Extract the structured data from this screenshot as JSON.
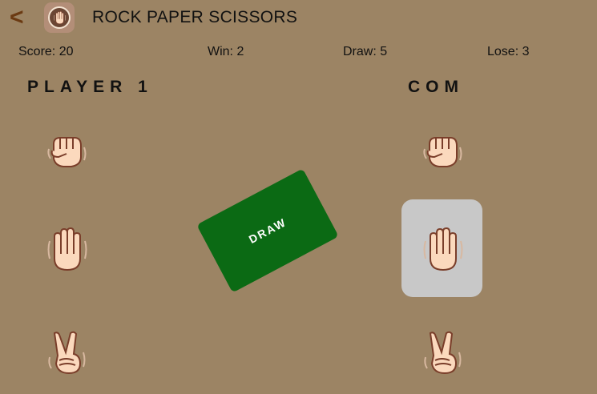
{
  "header": {
    "back_label": "<",
    "title": "ROCK PAPER SCISSORS"
  },
  "stats": {
    "score": "Score: 20",
    "win": "Win: 2",
    "draw": "Draw: 5",
    "lose": "Lose: 3"
  },
  "player": {
    "label": "PLAYER 1",
    "choices": [
      "rock-icon",
      "paper-icon",
      "scissors-icon"
    ]
  },
  "com": {
    "label": "COM",
    "choices": [
      "rock-icon",
      "paper-icon",
      "scissors-icon"
    ],
    "selected": "paper"
  },
  "result": {
    "label": "DRAW"
  },
  "colors": {
    "background": "#9c8464",
    "result_card": "#0b6a14",
    "selected_highlight": "#c8c8c8",
    "hand_skin": "#fbd9bd"
  }
}
